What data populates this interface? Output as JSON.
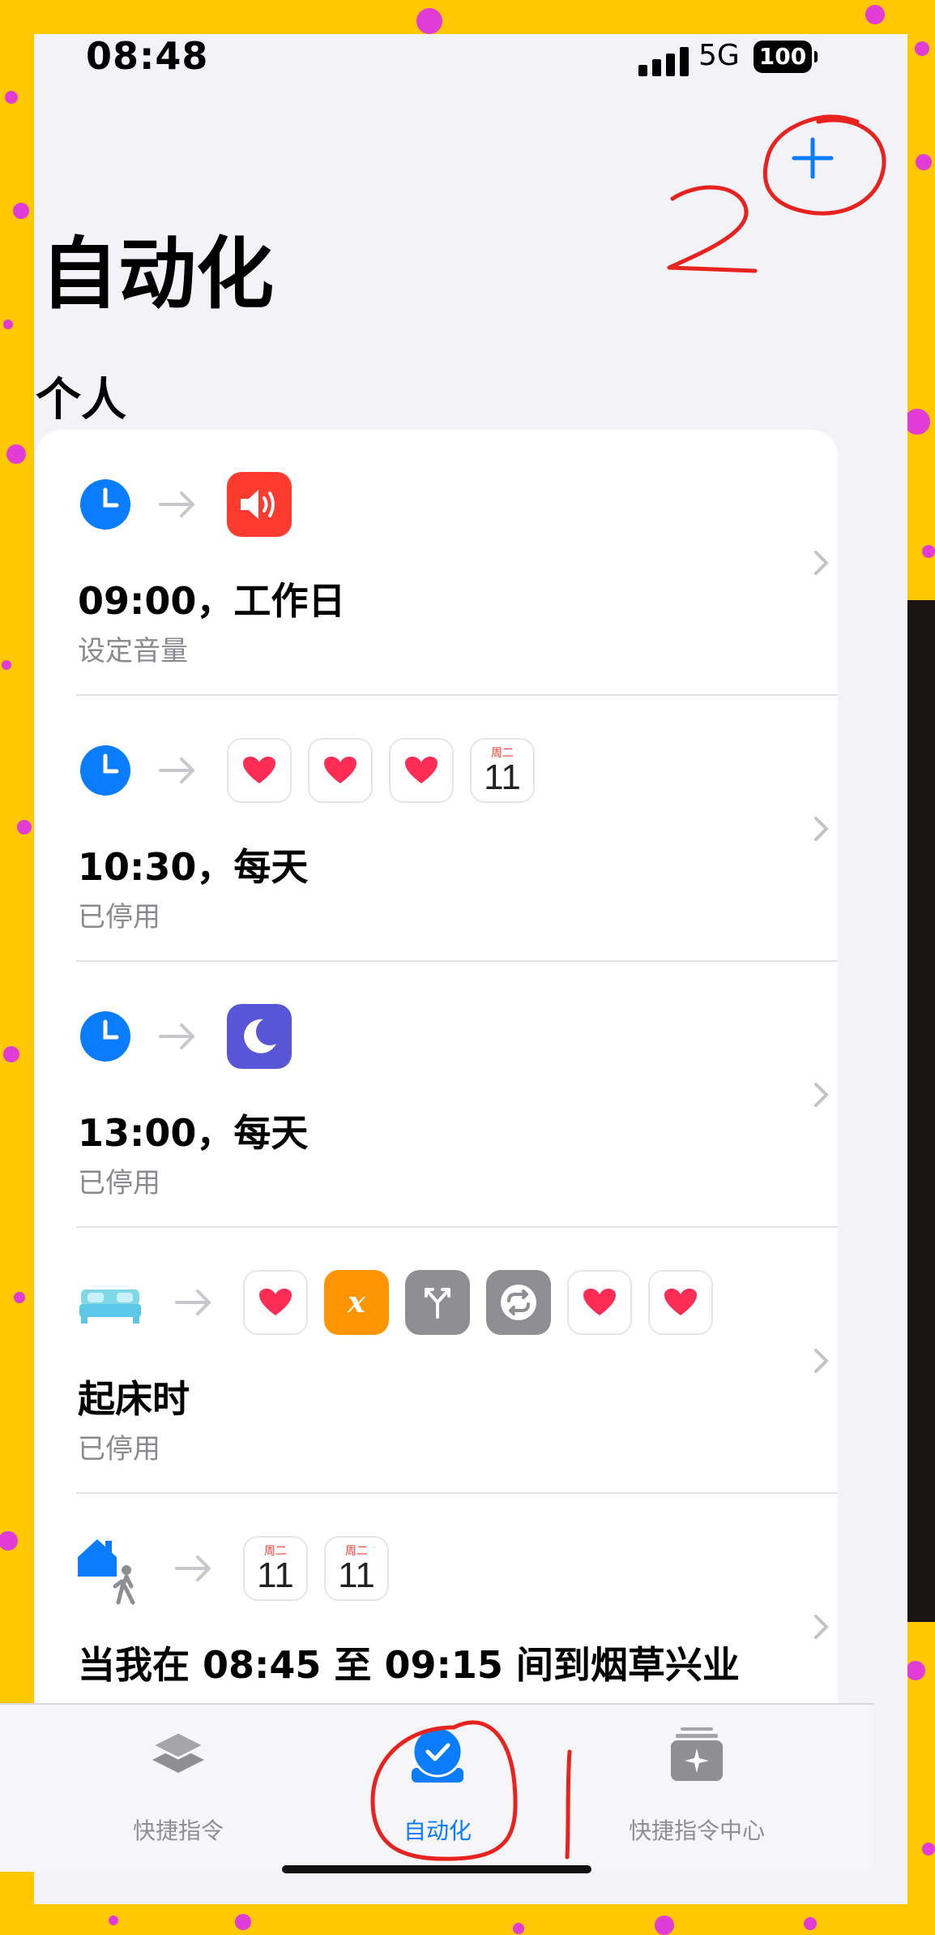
{
  "status_bar": {
    "time": "08:48",
    "network": "5G",
    "battery": "100"
  },
  "page": {
    "title": "自动化",
    "section": "个人",
    "add_button_icon": "plus-icon"
  },
  "automations": [
    {
      "trigger_icon": "clock-icon",
      "action_icons": [
        "sound-volume-icon"
      ],
      "title": "09:00，工作日",
      "subtitle": "设定音量"
    },
    {
      "trigger_icon": "clock-icon",
      "action_icons": [
        "health-heart-icon",
        "health-heart-icon",
        "health-heart-icon",
        "calendar-icon"
      ],
      "title": "10:30，每天",
      "subtitle": "已停用"
    },
    {
      "trigger_icon": "clock-icon",
      "action_icons": [
        "moon-icon"
      ],
      "title": "13:00，每天",
      "subtitle": "已停用"
    },
    {
      "trigger_icon": "bed-icon",
      "action_icons": [
        "health-heart-icon",
        "variable-icon",
        "branch-icon",
        "repeat-icon",
        "health-heart-icon",
        "health-heart-icon"
      ],
      "title": "起床时",
      "subtitle": "已停用"
    },
    {
      "trigger_icon": "arrive-home-icon",
      "action_icons": [
        "calendar-icon",
        "calendar-icon"
      ],
      "title": "当我在 08:45 至 09:15 间到烟草兴业",
      "subtitle": ""
    }
  ],
  "calendar": {
    "weekday": "周二",
    "day": "11"
  },
  "tabs": [
    {
      "label": "快捷指令",
      "icon": "layers-icon",
      "active": false
    },
    {
      "label": "自动化",
      "icon": "checkmark-circle-icon",
      "active": true
    },
    {
      "label": "快捷指令中心",
      "icon": "gallery-sparkle-icon",
      "active": false
    }
  ],
  "annotations": {
    "mark_1": "1",
    "mark_2": "2"
  },
  "colors": {
    "accent": "#0a7cff",
    "annotation": "#e8231f",
    "background": "#ffc800",
    "sound_red": "#ff3b30",
    "moon_indigo": "#5856d6",
    "variable_orange": "#ff9500",
    "tool_gray": "#8e8e93",
    "bed_cyan": "#5ac8fa"
  }
}
